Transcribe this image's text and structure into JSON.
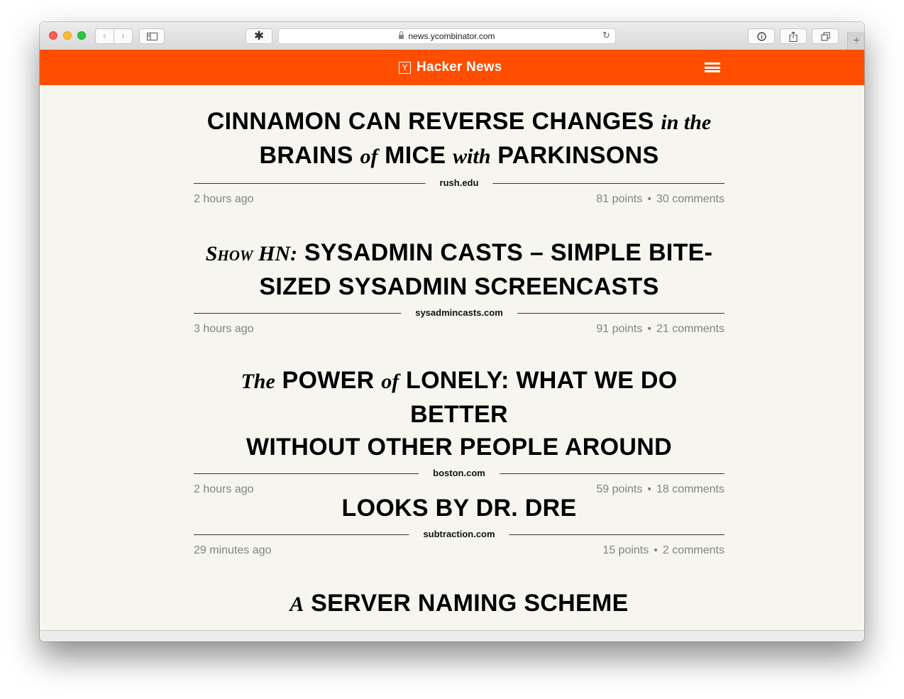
{
  "browser": {
    "url": "news.ycombinator.com",
    "extension_icon": "asterisk-icon",
    "buttons": {
      "back": "‹",
      "forward": "›",
      "reload": "↻",
      "new_tab": "+"
    }
  },
  "header": {
    "logo_letter": "Y",
    "title": "Hacker News",
    "menu_icon": "hamburger-menu-icon",
    "color": "#ff4e00"
  },
  "stories": [
    {
      "title_line1": [
        "CINNAMON CAN REVERSE CHANGES ",
        "in the"
      ],
      "title_line2": [
        "BRAINS ",
        "of",
        " MICE ",
        "with",
        " PARKINSONS"
      ],
      "domain": "rush.edu",
      "age": "2 hours ago",
      "points": "81 points",
      "comments": "30 comments"
    },
    {
      "title_prefix": "Show HN:",
      "title_line1": " SYSADMIN CASTS – SIMPLE BITE-",
      "title_line2": "SIZED SYSADMIN SCREENCASTS",
      "domain": "sysadmincasts.com",
      "age": "3 hours ago",
      "points": "91 points",
      "comments": "21 comments"
    },
    {
      "title_line1": [
        "The",
        " POWER ",
        "of",
        " LONELY: WHAT WE DO BETTER"
      ],
      "title_line2": "WITHOUT OTHER PEOPLE AROUND",
      "domain": "boston.com",
      "age": "2 hours ago",
      "points": "59 points",
      "comments": "18 comments"
    },
    {
      "title_line1": "LOOKS BY DR. DRE",
      "domain": "subtraction.com",
      "age": "29 minutes ago",
      "points": "15 points",
      "comments": "2 comments"
    },
    {
      "title_line1": [
        "A",
        " SERVER NAMING SCHEME"
      ]
    }
  ],
  "separator": "•"
}
